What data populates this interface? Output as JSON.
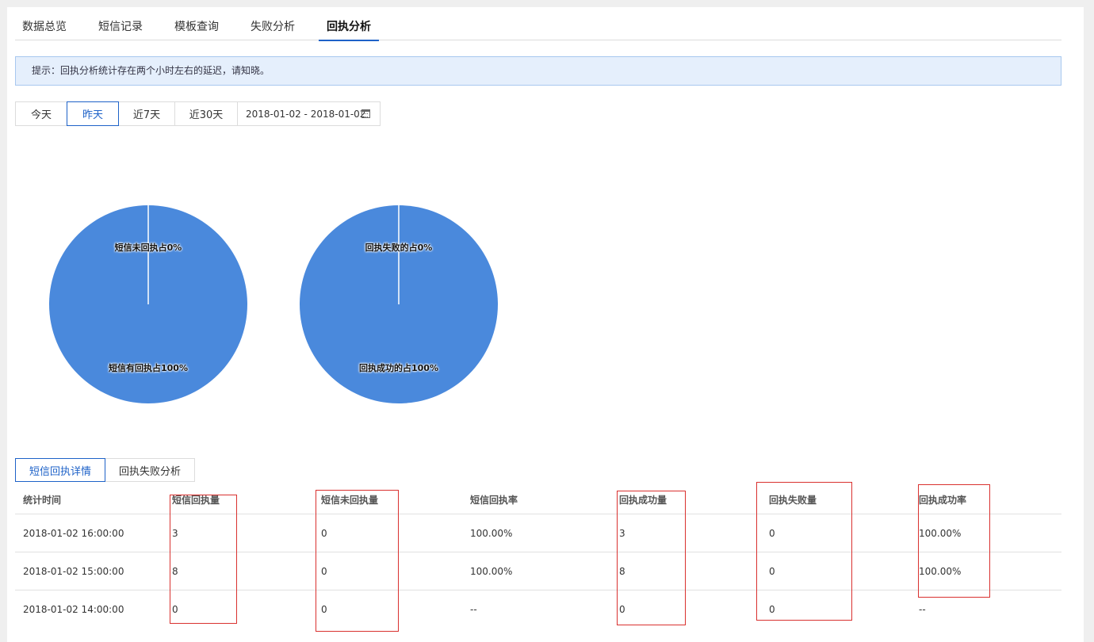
{
  "tabs": [
    {
      "label": "数据总览"
    },
    {
      "label": "短信记录"
    },
    {
      "label": "模板查询"
    },
    {
      "label": "失败分析"
    },
    {
      "label": "回执分析"
    }
  ],
  "active_tab": "回执分析",
  "notice": "提示：回执分析统计存在两个小时左右的延迟，请知晓。",
  "date_filter": {
    "options": [
      "今天",
      "昨天",
      "近7天",
      "近30天"
    ],
    "selected": "昨天",
    "range": "2018-01-02 - 2018-01-02"
  },
  "colors": {
    "pie_fill": "#4a89dc",
    "accent": "#1e62c8",
    "annotation": "#d9312f"
  },
  "chart_data": [
    {
      "type": "pie",
      "slices": [
        {
          "label": "短信未回执占0%",
          "value": 0
        },
        {
          "label": "短信有回执占100%",
          "value": 100
        }
      ]
    },
    {
      "type": "pie",
      "slices": [
        {
          "label": "回执失败的占0%",
          "value": 0
        },
        {
          "label": "回执成功的占100%",
          "value": 100
        }
      ]
    }
  ],
  "sub_tabs": [
    {
      "label": "短信回执详情"
    },
    {
      "label": "回执失败分析"
    }
  ],
  "table": {
    "headers": [
      "统计时间",
      "短信回执量",
      "短信未回执量",
      "短信回执率",
      "回执成功量",
      "回执失败量",
      "回执成功率"
    ],
    "rows": [
      [
        "2018-01-02 16:00:00",
        "3",
        "0",
        "100.00%",
        "3",
        "0",
        "100.00%"
      ],
      [
        "2018-01-02 15:00:00",
        "8",
        "0",
        "100.00%",
        "8",
        "0",
        "100.00%"
      ],
      [
        "2018-01-02 14:00:00",
        "0",
        "0",
        "--",
        "0",
        "0",
        "--"
      ]
    ]
  }
}
